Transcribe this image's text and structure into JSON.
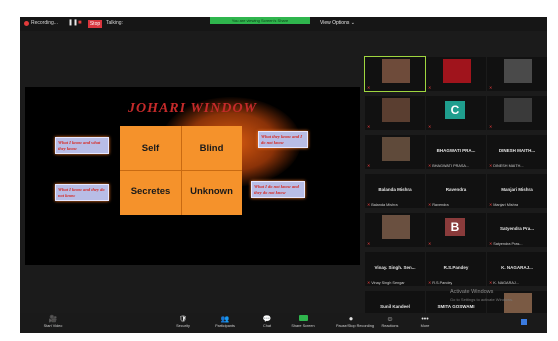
{
  "topbar": {
    "recording": "Recording...",
    "stop": "Stop",
    "talking": "Talking:",
    "share_banner": "You are viewing Screen's Share",
    "view_options": "View Options ⌄"
  },
  "slide": {
    "title": "JOHARI WINDOW",
    "quadrants": {
      "q1": "Self",
      "q2": "Blind",
      "q3": "Secretes",
      "q4": "Unknown"
    },
    "notes": {
      "top_left": "What I know and what they know",
      "bottom_left": "What I know and they do not know",
      "top_right": "What they know and I do not know",
      "bottom_right": "What I do not know and they do not know"
    },
    "accent_color": "#f5922b",
    "title_color": "#c42a2a"
  },
  "gallery": {
    "tiles": [
      {
        "name": "",
        "caption": "",
        "kind": "photo",
        "photo_color": "#6e4b3a",
        "active": true
      },
      {
        "name": "",
        "caption": "",
        "kind": "photo",
        "photo_color": "#a0141c"
      },
      {
        "name": "",
        "caption": "",
        "kind": "photo",
        "photo_color": "#4a4a4a"
      },
      {
        "name": "",
        "caption": "",
        "kind": "photo",
        "photo_color": "#5a3e30"
      },
      {
        "name": "",
        "caption": "",
        "kind": "letter",
        "letter": "C",
        "letter_bg": "#1f9e8e"
      },
      {
        "name": "",
        "caption": "",
        "kind": "photo",
        "photo_color": "#3a3a3a"
      },
      {
        "name": "",
        "caption": "",
        "kind": "photo",
        "photo_color": "#5f4a3a"
      },
      {
        "name": "BHAGWATI PRA...",
        "caption": "BHAGWATI PRASA...",
        "kind": "name"
      },
      {
        "name": "DINESH MAITH...",
        "caption": "DINESH MAITH...",
        "kind": "name"
      },
      {
        "name": "Balanda Mishra",
        "caption": "Balanda Mishra",
        "kind": "name"
      },
      {
        "name": "Ravendra",
        "caption": "Ravendra",
        "kind": "name"
      },
      {
        "name": "Manjari Mishra",
        "caption": "Manjari Mishra",
        "kind": "name"
      },
      {
        "name": "",
        "caption": "",
        "kind": "photo",
        "photo_color": "#6a5040"
      },
      {
        "name": "",
        "caption": "",
        "kind": "letter",
        "letter": "B",
        "letter_bg": "#8a3b3b"
      },
      {
        "name": "Satyendra Pra...",
        "caption": "Satyendra Pras...",
        "kind": "name"
      },
      {
        "name": "Vinay. Singh. Sen...",
        "caption": "Vinay Singh Sengar",
        "kind": "name"
      },
      {
        "name": "R.S.Pandey",
        "caption": "R.S.Pandey",
        "kind": "name"
      },
      {
        "name": "K. NAGARAJ...",
        "caption": "K. NAGARAJ...",
        "kind": "name"
      },
      {
        "name": "Sunil Kandeel",
        "caption": "Sunil Kandeel",
        "kind": "name"
      },
      {
        "name": "SMITA GOSWAMI",
        "caption": "SMITA GOSWAMI",
        "kind": "name"
      },
      {
        "name": "",
        "caption": "",
        "kind": "photo",
        "photo_color": "#7a5a44"
      }
    ],
    "watermark": "Activate Windows",
    "watermark_sub": "Go to Settings to activate Windows."
  },
  "toolbar": {
    "items": [
      {
        "label": "Start Video",
        "icon": "🎥"
      },
      {
        "label": "Security",
        "icon": "🛡"
      },
      {
        "label": "Participants",
        "icon": "👥"
      },
      {
        "label": "Chat",
        "icon": "💬"
      },
      {
        "label": "Share Screen",
        "icon": "share"
      },
      {
        "label": "Pause/Stop Recording",
        "icon": "⏺"
      },
      {
        "label": "Reactions",
        "icon": "☺"
      },
      {
        "label": "More",
        "icon": "•••"
      }
    ]
  }
}
